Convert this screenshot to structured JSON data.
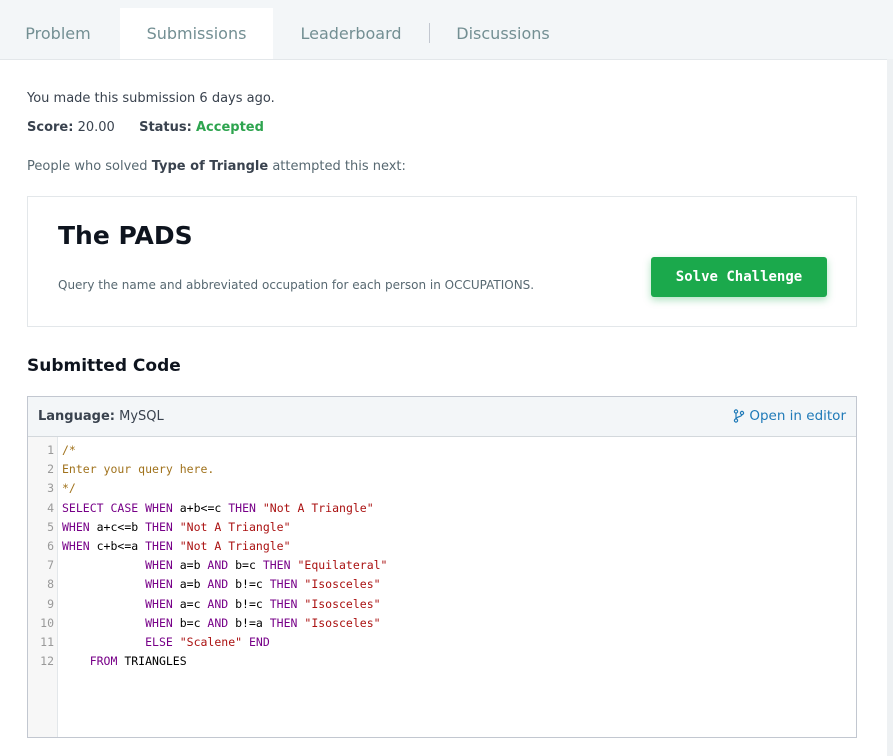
{
  "tabs": [
    {
      "label": "Problem",
      "active": false
    },
    {
      "label": "Submissions",
      "active": true
    },
    {
      "label": "Leaderboard",
      "active": false
    },
    {
      "label": "Discussions",
      "active": false
    }
  ],
  "submission": {
    "made_text": "You made this submission 6 days ago.",
    "score_label": "Score:",
    "score_value": "20.00",
    "status_label": "Status:",
    "status_value": "Accepted",
    "people_prefix": "People who solved ",
    "challenge_name": "Type of Triangle",
    "people_suffix": " attempted this next:"
  },
  "next_challenge": {
    "title": "The PADS",
    "description": "Query the name and abbreviated occupation for each person in OCCUPATIONS.",
    "button_label": "Solve Challenge"
  },
  "code": {
    "section_title": "Submitted Code",
    "language_label": "Language:",
    "language_value": "MySQL",
    "open_editor_label": "Open in editor",
    "lines": [
      {
        "num": "1",
        "tokens": [
          {
            "t": "/*",
            "c": "comment"
          }
        ]
      },
      {
        "num": "2",
        "tokens": [
          {
            "t": "Enter your query here.",
            "c": "comment"
          }
        ]
      },
      {
        "num": "3",
        "tokens": [
          {
            "t": "*/",
            "c": "comment"
          }
        ]
      },
      {
        "num": "4",
        "tokens": [
          {
            "t": "SELECT",
            "c": "keyword"
          },
          {
            "t": " ",
            "c": "plain"
          },
          {
            "t": "CASE",
            "c": "keyword"
          },
          {
            "t": " ",
            "c": "plain"
          },
          {
            "t": "WHEN",
            "c": "keyword"
          },
          {
            "t": " a+b<=c ",
            "c": "plain"
          },
          {
            "t": "THEN",
            "c": "keyword"
          },
          {
            "t": " ",
            "c": "plain"
          },
          {
            "t": "\"Not A Triangle\"",
            "c": "string"
          }
        ]
      },
      {
        "num": "5",
        "tokens": [
          {
            "t": "WHEN",
            "c": "keyword"
          },
          {
            "t": " a+c<=b ",
            "c": "plain"
          },
          {
            "t": "THEN",
            "c": "keyword"
          },
          {
            "t": " ",
            "c": "plain"
          },
          {
            "t": "\"Not A Triangle\"",
            "c": "string"
          }
        ]
      },
      {
        "num": "6",
        "tokens": [
          {
            "t": "WHEN",
            "c": "keyword"
          },
          {
            "t": " c+b<=a ",
            "c": "plain"
          },
          {
            "t": "THEN",
            "c": "keyword"
          },
          {
            "t": " ",
            "c": "plain"
          },
          {
            "t": "\"Not A Triangle\"",
            "c": "string"
          }
        ]
      },
      {
        "num": "7",
        "tokens": [
          {
            "t": "            ",
            "c": "plain"
          },
          {
            "t": "WHEN",
            "c": "keyword"
          },
          {
            "t": " a=b ",
            "c": "plain"
          },
          {
            "t": "AND",
            "c": "keyword"
          },
          {
            "t": " b=c ",
            "c": "plain"
          },
          {
            "t": "THEN",
            "c": "keyword"
          },
          {
            "t": " ",
            "c": "plain"
          },
          {
            "t": "\"Equilateral\"",
            "c": "string"
          }
        ]
      },
      {
        "num": "8",
        "tokens": [
          {
            "t": "            ",
            "c": "plain"
          },
          {
            "t": "WHEN",
            "c": "keyword"
          },
          {
            "t": " a=b ",
            "c": "plain"
          },
          {
            "t": "AND",
            "c": "keyword"
          },
          {
            "t": " b!=c ",
            "c": "plain"
          },
          {
            "t": "THEN",
            "c": "keyword"
          },
          {
            "t": " ",
            "c": "plain"
          },
          {
            "t": "\"Isosceles\"",
            "c": "string"
          }
        ]
      },
      {
        "num": "9",
        "tokens": [
          {
            "t": "            ",
            "c": "plain"
          },
          {
            "t": "WHEN",
            "c": "keyword"
          },
          {
            "t": " a=c ",
            "c": "plain"
          },
          {
            "t": "AND",
            "c": "keyword"
          },
          {
            "t": " b!=c ",
            "c": "plain"
          },
          {
            "t": "THEN",
            "c": "keyword"
          },
          {
            "t": " ",
            "c": "plain"
          },
          {
            "t": "\"Isosceles\"",
            "c": "string"
          }
        ]
      },
      {
        "num": "10",
        "tokens": [
          {
            "t": "            ",
            "c": "plain"
          },
          {
            "t": "WHEN",
            "c": "keyword"
          },
          {
            "t": " b=c ",
            "c": "plain"
          },
          {
            "t": "AND",
            "c": "keyword"
          },
          {
            "t": " b!=a ",
            "c": "plain"
          },
          {
            "t": "THEN",
            "c": "keyword"
          },
          {
            "t": " ",
            "c": "plain"
          },
          {
            "t": "\"Isosceles\"",
            "c": "string"
          }
        ]
      },
      {
        "num": "11",
        "tokens": [
          {
            "t": "            ",
            "c": "plain"
          },
          {
            "t": "ELSE",
            "c": "keyword"
          },
          {
            "t": " ",
            "c": "plain"
          },
          {
            "t": "\"Scalene\"",
            "c": "string"
          },
          {
            "t": " ",
            "c": "plain"
          },
          {
            "t": "END",
            "c": "keyword"
          }
        ]
      },
      {
        "num": "12",
        "tokens": [
          {
            "t": "    ",
            "c": "plain"
          },
          {
            "t": "FROM",
            "c": "keyword"
          },
          {
            "t": " TRIANGLES",
            "c": "plain"
          }
        ]
      }
    ]
  },
  "colors": {
    "accepted": "#2ea44f",
    "solve_button": "#1ba94c",
    "link": "#1f7ab8",
    "keyword": "#770088",
    "string": "#aa1111",
    "comment": "#a0721c"
  },
  "icons": {
    "open_editor": "git-branch-icon"
  }
}
